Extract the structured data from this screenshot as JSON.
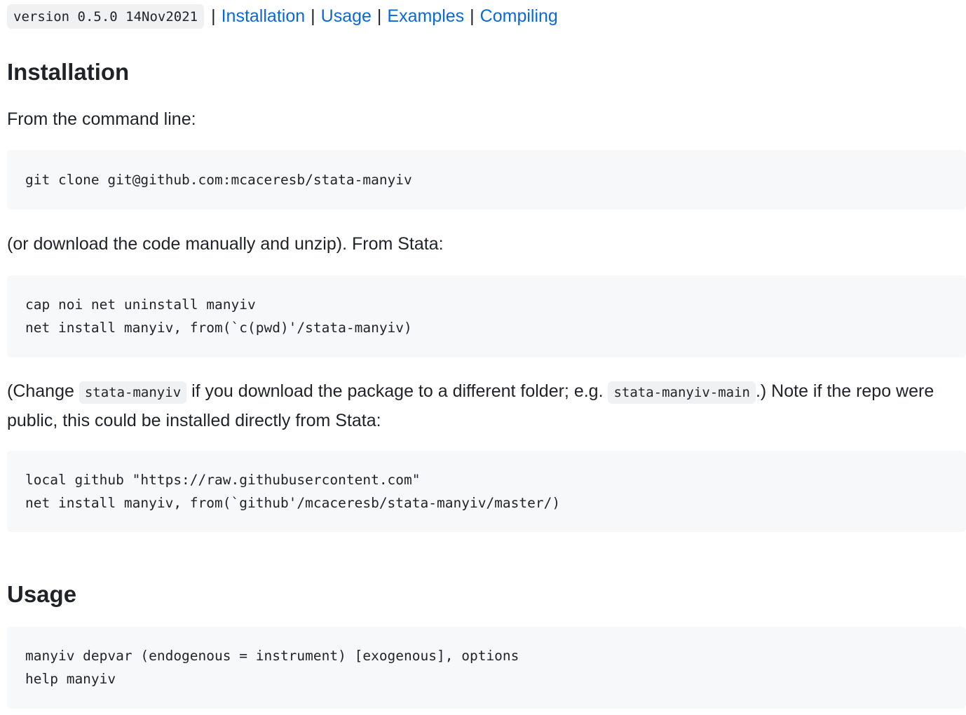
{
  "header": {
    "version": "version 0.5.0 14Nov2021",
    "separator": "|",
    "links": [
      "Installation",
      "Usage",
      "Examples",
      "Compiling"
    ]
  },
  "installation": {
    "heading": "Installation",
    "intro": "From the command line:",
    "code1": [
      "git clone git@github.com:mcaceresb/stata-manyiv"
    ],
    "para2": "(or download the code manually and unzip). From Stata:",
    "code2": [
      "cap noi net uninstall manyiv",
      "net install manyiv, from(`c(pwd)'/stata-manyiv)"
    ],
    "para3": {
      "t1": "(Change ",
      "c1": "stata-manyiv",
      "t2": " if you download the package to a different folder; e.g. ",
      "c2": "stata-manyiv-main",
      "t3": ".) Note if the repo were public, this could be installed directly from Stata:"
    },
    "code3": [
      "local github \"https://raw.githubusercontent.com\"",
      "net install manyiv, from(`github'/mcaceresb/stata-manyiv/master/)"
    ]
  },
  "usage": {
    "heading": "Usage",
    "code": [
      "manyiv depvar (endogenous = instrument) [exogenous], options",
      "help manyiv"
    ]
  },
  "colors": {
    "link": "#0969da",
    "text": "#1f2328",
    "code_bg": "#f6f8fa",
    "inline_code_bg": "#eff1f3"
  }
}
